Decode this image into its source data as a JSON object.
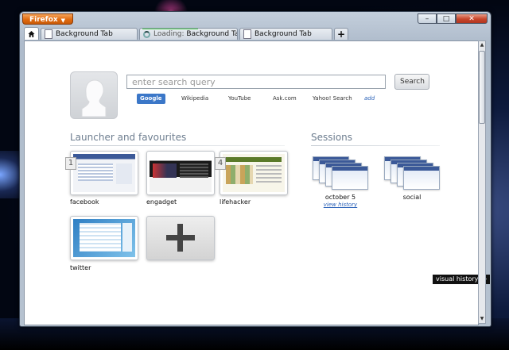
{
  "window": {
    "app_menu_label": "Firefox",
    "controls": {
      "minimize": "–",
      "maximize": "□",
      "close": "✕"
    }
  },
  "tabs": [
    {
      "label": "Background Tab",
      "state": "normal"
    },
    {
      "prefix": "Loading:",
      "label": "Background Tab",
      "state": "loading"
    },
    {
      "label": "Background Tab",
      "state": "normal"
    }
  ],
  "new_tab_label": "+",
  "search": {
    "placeholder": "enter search query",
    "button_label": "Search",
    "engines": [
      {
        "label": "Google",
        "selected": true
      },
      {
        "label": "Wikipedia",
        "selected": false
      },
      {
        "label": "YouTube",
        "selected": false
      },
      {
        "label": "Ask.com",
        "selected": false
      },
      {
        "label": "Yahoo! Search",
        "selected": false
      }
    ],
    "add_label": "add"
  },
  "launcher": {
    "title": "Launcher and favourites",
    "tiles": [
      {
        "label": "facebook",
        "badge": "1"
      },
      {
        "label": "engadget",
        "badge": ""
      },
      {
        "label": "lifehacker",
        "badge": "4"
      },
      {
        "label": "twitter",
        "badge": ""
      }
    ]
  },
  "sessions": {
    "title": "Sessions",
    "items": [
      {
        "label": "october 5",
        "link": "view history"
      },
      {
        "label": "social",
        "link": ""
      }
    ]
  },
  "visual_history": {
    "label": "visual history",
    "arrow": "➡"
  },
  "colors": {
    "accent": "#3b77c8",
    "firefox_orange": "#e06a10",
    "close_red": "#c7452b"
  }
}
